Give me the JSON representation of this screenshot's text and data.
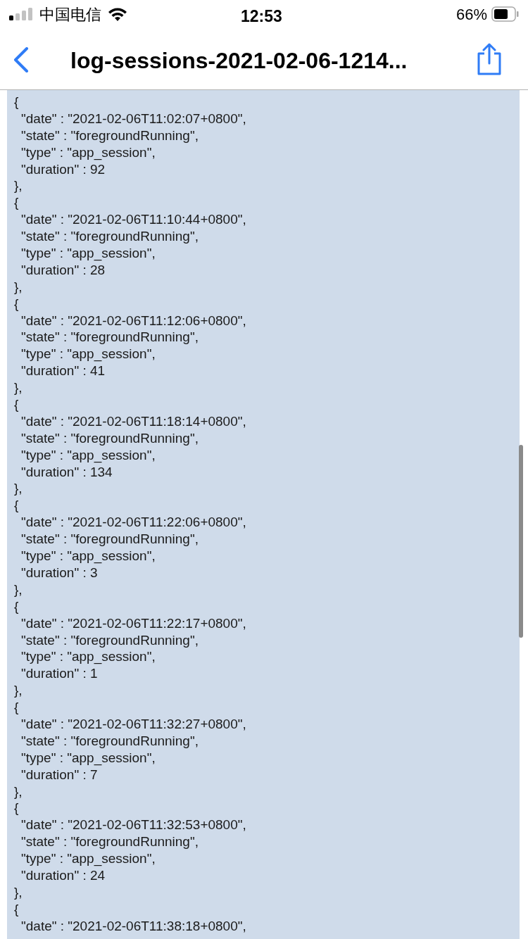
{
  "status_bar": {
    "carrier": "中国电信",
    "time": "12:53",
    "battery": "66%"
  },
  "nav": {
    "title": "log-sessions-2021-02-06-1214..."
  },
  "records": [
    {
      "open": "{",
      "fields": [
        "\"date\" : \"2021-02-06T11:02:07+0800\",",
        "\"state\" : \"foregroundRunning\",",
        "\"type\" : \"app_session\",",
        "\"duration\" : 92"
      ],
      "close": "},"
    },
    {
      "open": "{",
      "fields": [
        "\"date\" : \"2021-02-06T11:10:44+0800\",",
        "\"state\" : \"foregroundRunning\",",
        "\"type\" : \"app_session\",",
        "\"duration\" : 28"
      ],
      "close": "},"
    },
    {
      "open": "{",
      "fields": [
        "\"date\" : \"2021-02-06T11:12:06+0800\",",
        "\"state\" : \"foregroundRunning\",",
        "\"type\" : \"app_session\",",
        "\"duration\" : 41"
      ],
      "close": "},"
    },
    {
      "open": "{",
      "fields": [
        "\"date\" : \"2021-02-06T11:18:14+0800\",",
        "\"state\" : \"foregroundRunning\",",
        "\"type\" : \"app_session\",",
        "\"duration\" : 134"
      ],
      "close": "},"
    },
    {
      "open": "{",
      "fields": [
        "\"date\" : \"2021-02-06T11:22:06+0800\",",
        "\"state\" : \"foregroundRunning\",",
        "\"type\" : \"app_session\",",
        "\"duration\" : 3"
      ],
      "close": "},"
    },
    {
      "open": "{",
      "fields": [
        "\"date\" : \"2021-02-06T11:22:17+0800\",",
        "\"state\" : \"foregroundRunning\",",
        "\"type\" : \"app_session\",",
        "\"duration\" : 1"
      ],
      "close": "},"
    },
    {
      "open": "{",
      "fields": [
        "\"date\" : \"2021-02-06T11:32:27+0800\",",
        "\"state\" : \"foregroundRunning\",",
        "\"type\" : \"app_session\",",
        "\"duration\" : 7"
      ],
      "close": "},"
    },
    {
      "open": "{",
      "fields": [
        "\"date\" : \"2021-02-06T11:32:53+0800\",",
        "\"state\" : \"foregroundRunning\",",
        "\"type\" : \"app_session\",",
        "\"duration\" : 24"
      ],
      "close": "},"
    },
    {
      "open": "{",
      "fields": [
        "\"date\" : \"2021-02-06T11:38:18+0800\","
      ]
    }
  ]
}
